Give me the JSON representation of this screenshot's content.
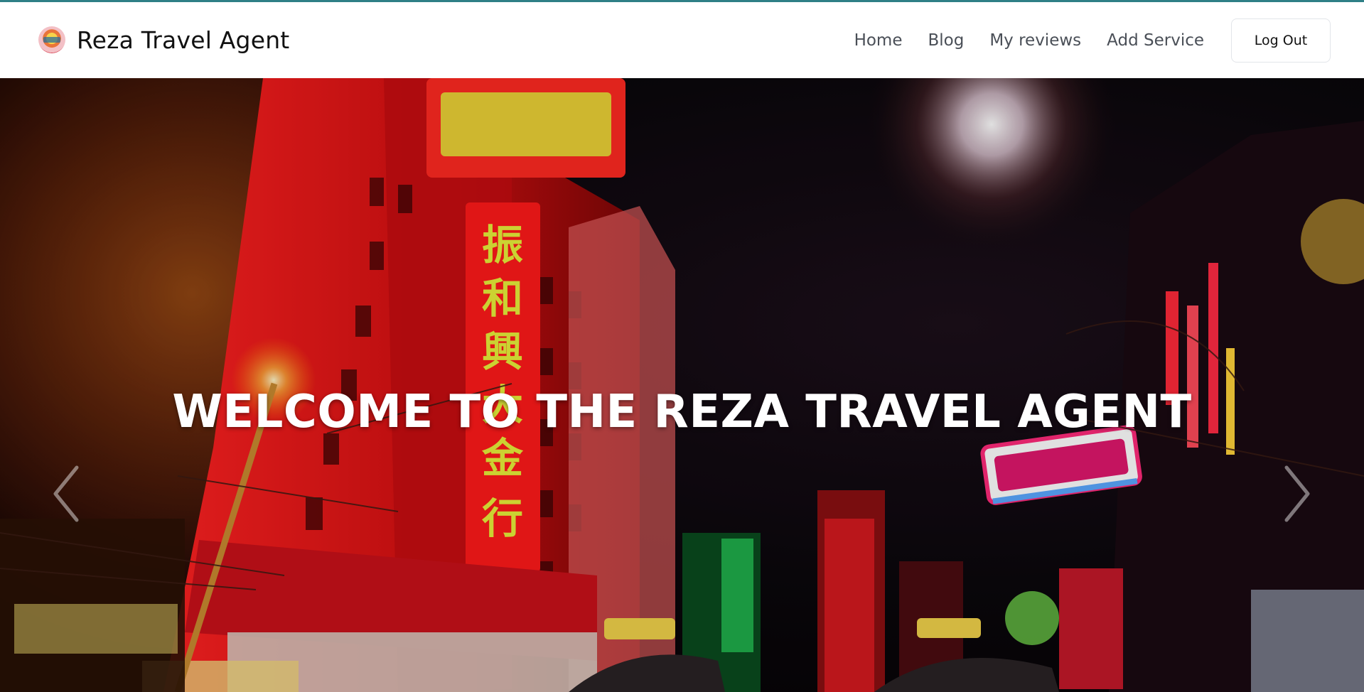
{
  "brand": {
    "name": "Reza Travel Agent",
    "logo_icon": "brand-logo-badge"
  },
  "nav": {
    "links": [
      {
        "label": "Home"
      },
      {
        "label": "Blog"
      },
      {
        "label": "My reviews"
      },
      {
        "label": "Add Service"
      }
    ],
    "logout_label": "Log Out"
  },
  "hero": {
    "title": "WELCOME TO THE REZA TRAVEL AGENT",
    "prev_icon": "chevron-left-icon",
    "next_icon": "chevron-right-icon"
  },
  "colors": {
    "accent_line": "#2f7f86",
    "neon_red": "#ff1a1a",
    "neon_yellow": "#e8ef3a"
  }
}
